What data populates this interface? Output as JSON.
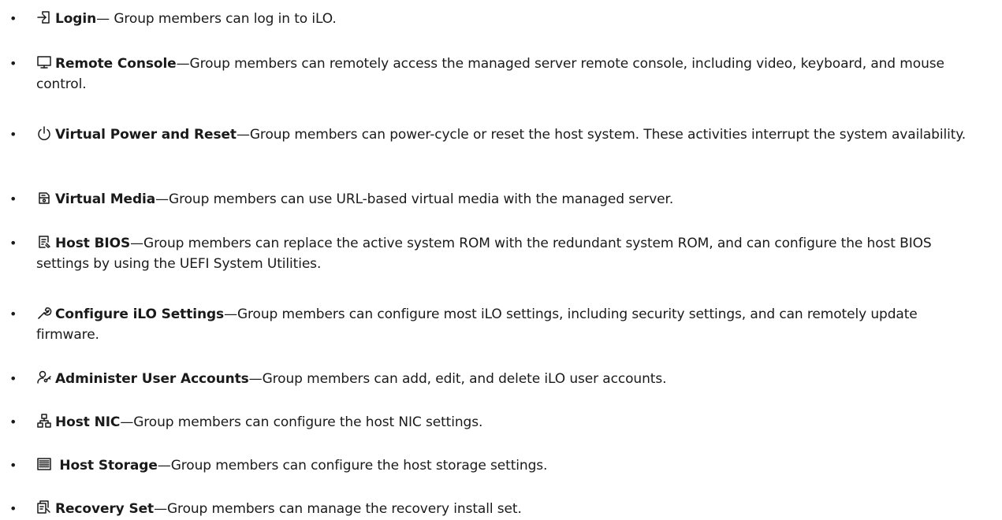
{
  "items": [
    {
      "icon": "login-icon",
      "term": "Login",
      "desc": "— Group members can log in to iLO."
    },
    {
      "icon": "monitor-icon",
      "term": "Remote Console",
      "desc": "—Group members can remotely access the managed server remote console, including video, keyboard, and mouse control."
    },
    {
      "icon": "power-icon",
      "term": "Virtual Power and Reset",
      "desc": "—Group members can power-cycle or reset the host system. These activities interrupt the system availability."
    },
    {
      "icon": "virtual-media-icon",
      "term": "Virtual Media",
      "desc": "—Group members can use URL-based virtual media with the managed server."
    },
    {
      "icon": "host-bios-icon",
      "term": "Host BIOS",
      "desc": "—Group members can replace the active system ROM with the redundant system ROM, and can configure the host BIOS settings by using the UEFI System Utilities."
    },
    {
      "icon": "wrench-icon",
      "term": "Configure iLO Settings",
      "desc": "—Group members can configure most iLO settings, including security settings, and can remotely update firmware."
    },
    {
      "icon": "user-key-icon",
      "term": "Administer User Accounts",
      "desc": "—Group members can add, edit, and delete iLO user accounts."
    },
    {
      "icon": "network-icon",
      "term": "Host NIC",
      "desc": "—Group members can configure the host NIC settings."
    },
    {
      "icon": "storage-icon",
      "term": "Host Storage",
      "desc": "—Group members can configure the host storage settings."
    },
    {
      "icon": "recovery-set-icon",
      "term": "Recovery Set",
      "desc": "—Group members can manage the recovery install set."
    }
  ]
}
